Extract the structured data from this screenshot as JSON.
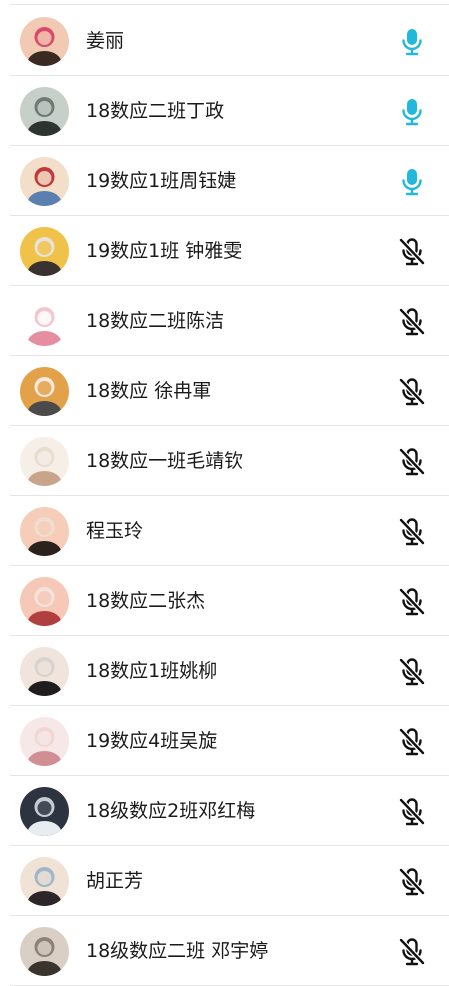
{
  "members": [
    {
      "name": "姜丽",
      "mic": "mic-on",
      "avatar_colors": [
        "#d94a6a",
        "#f2c9b3",
        "#3b2a22"
      ]
    },
    {
      "name": "18数应二班丁政",
      "mic": "mic-on",
      "avatar_colors": [
        "#6f7a73",
        "#c7cfc9",
        "#2e3531"
      ]
    },
    {
      "name": "19数应1班周钰婕",
      "mic": "mic-on",
      "avatar_colors": [
        "#c0393b",
        "#f3dfc9",
        "#5a7fb0"
      ]
    },
    {
      "name": "19数应1班 钟雅雯",
      "mic": "mic-off",
      "avatar_colors": [
        "#e7e2da",
        "#f1c24a",
        "#3a3230"
      ]
    },
    {
      "name": "18数应二班陈洁",
      "mic": "mic-off",
      "avatar_colors": [
        "#f3c6cf",
        "#ffffff",
        "#e58ea2"
      ]
    },
    {
      "name": "18数应 徐冉軍",
      "mic": "mic-off",
      "avatar_colors": [
        "#f3e9dc",
        "#e3a24a",
        "#4b4b4b"
      ]
    },
    {
      "name": "18数应一班毛靖钦",
      "mic": "mic-off",
      "avatar_colors": [
        "#e9ddd0",
        "#f6efe7",
        "#c8a58a"
      ]
    },
    {
      "name": "程玉玲",
      "mic": "mic-off",
      "avatar_colors": [
        "#f1ded2",
        "#f5cdb8",
        "#2b211d"
      ]
    },
    {
      "name": "18数应二张杰",
      "mic": "mic-off",
      "avatar_colors": [
        "#f4e3dc",
        "#f6c8b8",
        "#b0403f"
      ]
    },
    {
      "name": "18数应1班姚柳",
      "mic": "mic-off",
      "avatar_colors": [
        "#d7d4cf",
        "#f0e4dc",
        "#1f1d1d"
      ]
    },
    {
      "name": "19数应4班吴旋",
      "mic": "mic-off",
      "avatar_colors": [
        "#f1d6d4",
        "#f6e8e6",
        "#d18e95"
      ]
    },
    {
      "name": "18级数应2班邓红梅",
      "mic": "mic-off",
      "avatar_colors": [
        "#c5ccd3",
        "#2d3440",
        "#e8edf2"
      ]
    },
    {
      "name": "胡正芳",
      "mic": "mic-off",
      "avatar_colors": [
        "#9fb7c8",
        "#f1e2d6",
        "#2c2628"
      ]
    },
    {
      "name": "18级数应二班 邓宇婷",
      "mic": "mic-off",
      "avatar_colors": [
        "#8d8279",
        "#d9cfc4",
        "#3b332d"
      ]
    }
  ],
  "colors": {
    "mic_on": "#22b8dc",
    "mic_off": "#111111",
    "divider": "#e6e6e6",
    "text": "#1a1a1a"
  }
}
